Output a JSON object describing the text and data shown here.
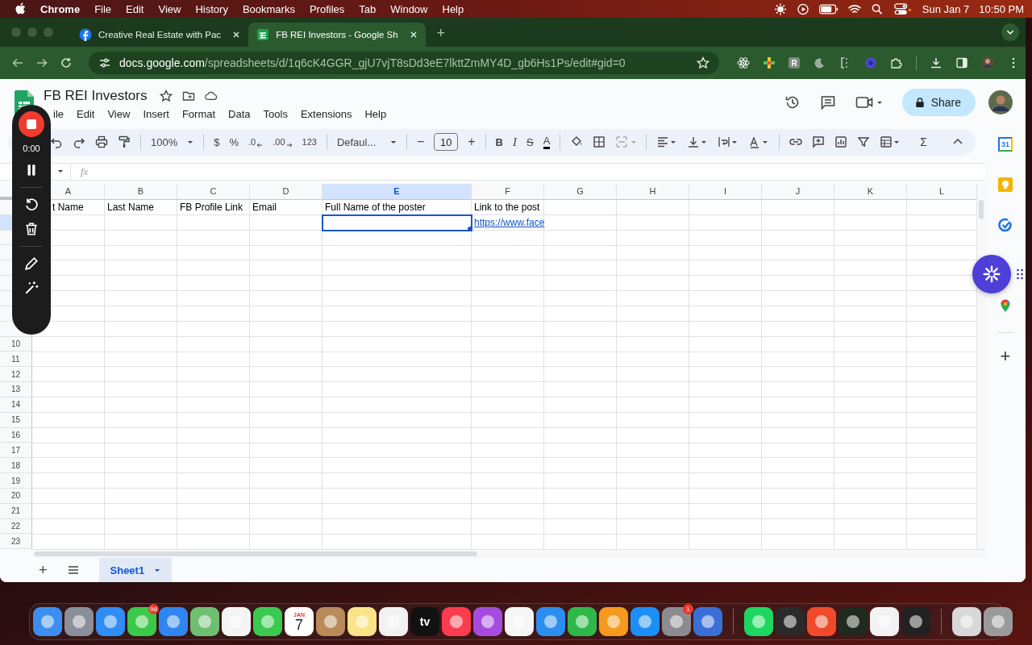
{
  "menubar": {
    "app": "Chrome",
    "menus": [
      "File",
      "Edit",
      "View",
      "History",
      "Bookmarks",
      "Profiles",
      "Tab",
      "Window",
      "Help"
    ],
    "date": "Sun Jan 7",
    "time": "10:50 PM"
  },
  "browser": {
    "tabs": [
      {
        "title": "Creative Real Estate with Pac",
        "selected": false
      },
      {
        "title": "FB REI Investors - Google Sh",
        "selected": true
      }
    ],
    "new_tab": "+",
    "url_host": "docs.google.com",
    "url_path": "/spreadsheets/d/1q6cK4GGR_gjU7vjT8sDd3eE7lkttZmMY4D_gb6Hs1Ps/edit#gid=0",
    "extension_letter": "R"
  },
  "sheets": {
    "title": "FB REI Investors",
    "menus": [
      "ile",
      "Edit",
      "View",
      "Insert",
      "Format",
      "Data",
      "Tools",
      "Extensions",
      "Help"
    ],
    "share": "Share",
    "toolbar": {
      "zoom": "100%",
      "currency": "$",
      "percent": "%",
      "decrease_decimal": ".0",
      "increase_decimal": ".00",
      "number_format": "123",
      "font": "Defaul...",
      "decrease_size": "−",
      "font_size": "10",
      "increase_size": "+",
      "bold": "B",
      "italic": "I",
      "strikethrough": "S",
      "text_color": "A",
      "sum": "Σ"
    },
    "formula_label": "fx",
    "columns": [
      {
        "label": "A",
        "selected": false
      },
      {
        "label": "B",
        "selected": false
      },
      {
        "label": "C",
        "selected": false
      },
      {
        "label": "D",
        "selected": false
      },
      {
        "label": "E",
        "selected": true
      },
      {
        "label": "F",
        "selected": false
      },
      {
        "label": "G",
        "selected": false
      },
      {
        "label": "H",
        "selected": false
      },
      {
        "label": "I",
        "selected": false
      },
      {
        "label": "J",
        "selected": false
      },
      {
        "label": "K",
        "selected": false
      },
      {
        "label": "L",
        "selected": false
      }
    ],
    "rows": [
      {
        "selected": false,
        "cells": [
          {
            "kind": "text",
            "text": "t Name",
            "selected": false
          },
          {
            "kind": "text",
            "text": "Last Name",
            "selected": false
          },
          {
            "kind": "text",
            "text": "FB Profile Link",
            "selected": false
          },
          {
            "kind": "text",
            "text": "Email",
            "selected": false
          },
          {
            "kind": "text",
            "text": "Full Name of the poster",
            "selected": false
          },
          {
            "kind": "text",
            "text": "Link to the post",
            "selected": false
          },
          {
            "selected": false
          },
          {
            "selected": false
          },
          {
            "selected": false
          },
          {
            "selected": false
          },
          {
            "selected": false
          },
          {
            "selected": false
          }
        ]
      },
      {
        "selected": true,
        "cells": [
          {
            "selected": false
          },
          {
            "selected": false
          },
          {
            "selected": false
          },
          {
            "selected": false
          },
          {
            "selected": true
          },
          {
            "kind": "link",
            "text": "https://www.face",
            "selected": false
          },
          {
            "selected": false
          },
          {
            "selected": false
          },
          {
            "selected": false
          },
          {
            "selected": false
          },
          {
            "selected": false
          },
          {
            "selected": false
          }
        ]
      },
      {
        "selected": false
      },
      {
        "selected": false
      },
      {
        "selected": false
      },
      {
        "selected": false
      },
      {
        "selected": false
      },
      {
        "selected": false
      },
      {
        "selected": false
      },
      {
        "selected": false,
        "number": "10"
      },
      {
        "selected": false,
        "number": "11"
      },
      {
        "selected": false,
        "number": "12"
      },
      {
        "selected": false,
        "number": "13"
      },
      {
        "selected": false,
        "number": "14"
      },
      {
        "selected": false,
        "number": "15"
      },
      {
        "selected": false,
        "number": "16"
      },
      {
        "selected": false,
        "number": "17"
      },
      {
        "selected": false,
        "number": "18"
      },
      {
        "selected": false,
        "number": "19"
      },
      {
        "selected": false,
        "number": "20"
      },
      {
        "selected": false,
        "number": "21"
      },
      {
        "selected": false,
        "number": "22"
      },
      {
        "selected": false,
        "number": "23"
      }
    ],
    "add_sheet": "+",
    "sheet_tabs": [
      {
        "label": "Sheet1",
        "selected": true
      }
    ],
    "calendar_day": "31",
    "side_add": "+"
  },
  "recorder": {
    "timer": "0:00"
  },
  "dock": {
    "messages_badge": "98",
    "calendar_month": "JAN",
    "calendar_day": "7",
    "tv_label": "tv",
    "settings_badge": "1"
  }
}
